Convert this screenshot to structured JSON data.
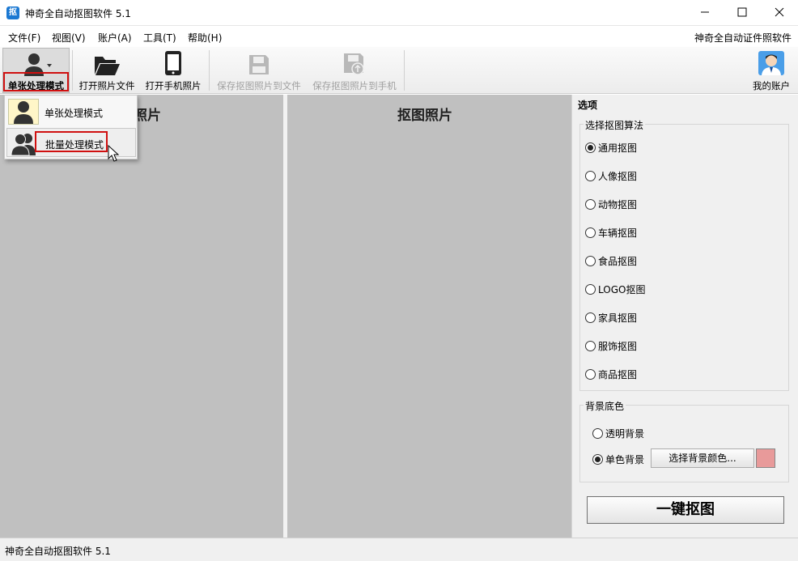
{
  "window": {
    "title": "神奇全自动抠图软件 5.1",
    "app_icon_text": "抠"
  },
  "menu": {
    "items": [
      "文件(F)",
      "视图(V)",
      "账户(A)",
      "工具(T)",
      "帮助(H)"
    ],
    "right_link": "神奇全自动证件照软件"
  },
  "toolbar": {
    "mode_label": "单张处理模式",
    "open_file": "打开照片文件",
    "open_phone": "打开手机照片",
    "save_file": "保存抠图照片到文件",
    "save_phone": "保存抠图照片到手机",
    "account": "我的账户"
  },
  "dropdown": {
    "single": "单张处理模式",
    "batch": "批量处理模式"
  },
  "canvas": {
    "left_title": "照片",
    "right_title": "抠图照片"
  },
  "sidebar": {
    "header": "选项",
    "algo_group": "选择抠图算法",
    "algorithms": [
      "通用抠图",
      "人像抠图",
      "动物抠图",
      "车辆抠图",
      "食品抠图",
      "LOGO抠图",
      "家具抠图",
      "服饰抠图",
      "商品抠图"
    ],
    "selected_algorithm": 0,
    "bg_group": "背景底色",
    "bg_transparent": "透明背景",
    "bg_solid": "单色背景",
    "choose_color": "选择背景颜色...",
    "bg_color": "#e89a9a",
    "run_button": "一键抠图"
  },
  "status": {
    "text": "神奇全自动抠图软件 5.1"
  },
  "colors": {
    "highlight": "#d01010",
    "canvas": "#c0c0c0"
  }
}
